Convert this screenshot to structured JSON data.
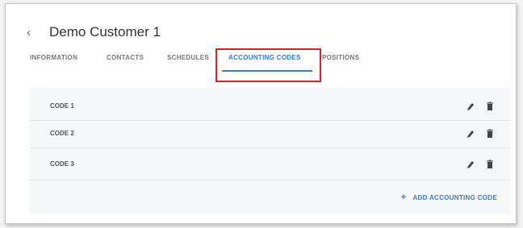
{
  "header": {
    "title": "Demo Customer 1"
  },
  "tabs": [
    {
      "label": "INFORMATION"
    },
    {
      "label": "CONTACTS"
    },
    {
      "label": "SCHEDULES"
    },
    {
      "label": "ACCOUNTING CODES"
    },
    {
      "label": "POSITIONS"
    }
  ],
  "active_tab": "ACCOUNTING CODES",
  "codes": [
    {
      "label": "CODE 1"
    },
    {
      "label": "CODE 2"
    },
    {
      "label": "CODE 3"
    }
  ],
  "actions": {
    "add_label": "ADD ACCOUNTING CODE"
  },
  "icons": {
    "back": "chevron-left-icon",
    "edit": "pencil-icon",
    "delete": "trash-icon",
    "add": "plus-icon"
  },
  "colors": {
    "accent": "#3a7bd5",
    "highlight": "#e31b23"
  }
}
